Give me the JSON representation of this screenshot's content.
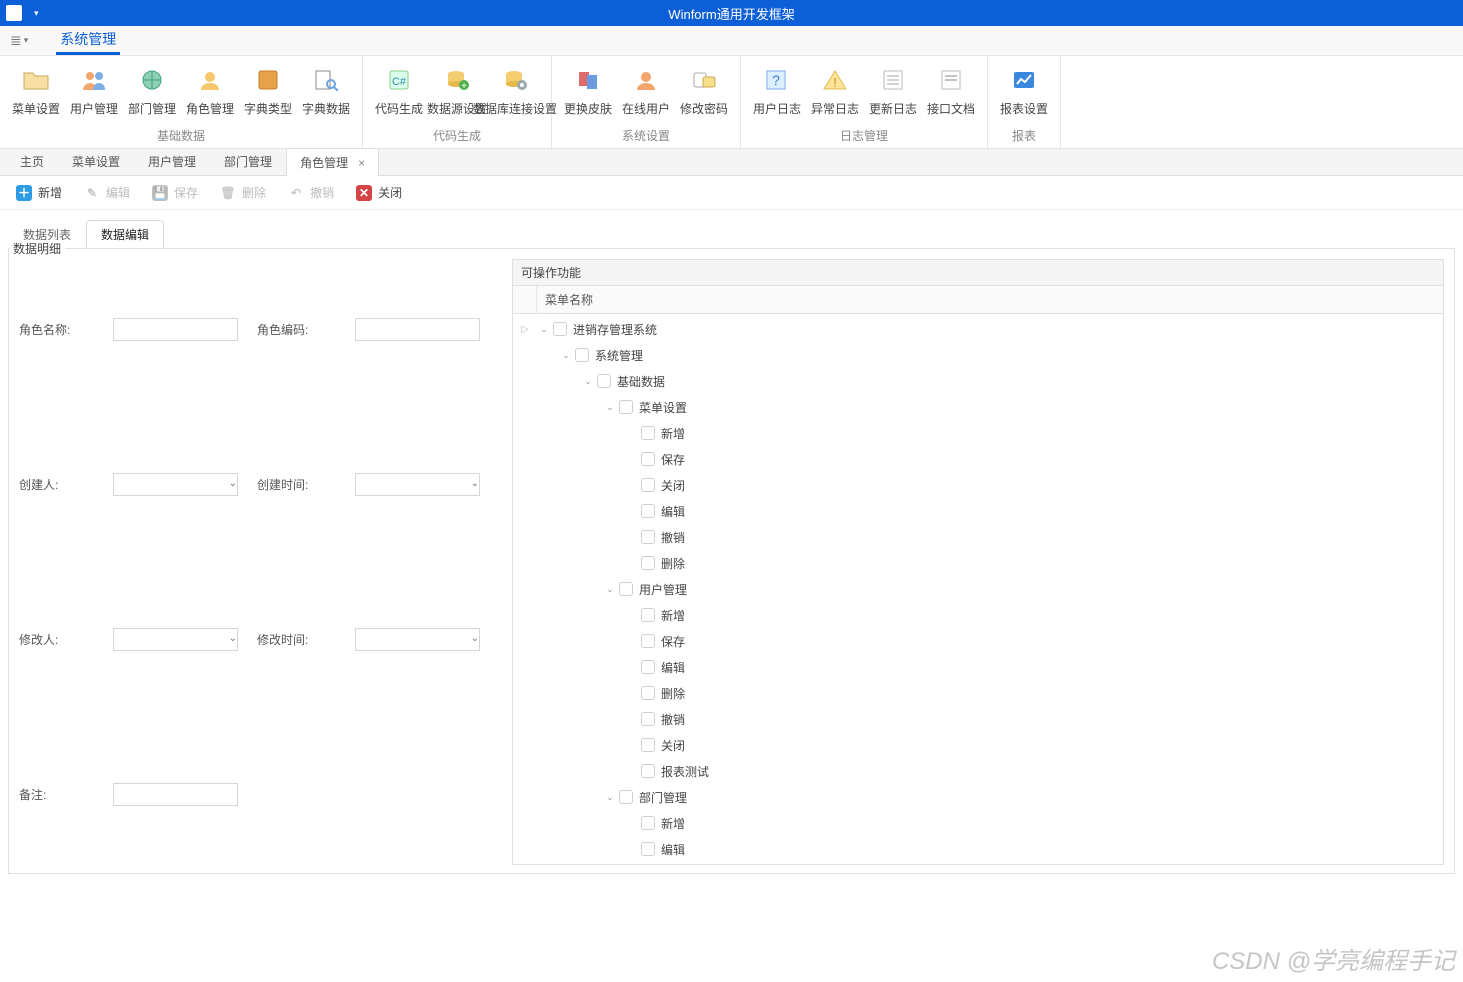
{
  "titlebar": {
    "caption": "Winform通用开发框架"
  },
  "menubar": {
    "dropdown_icon": "≣▾",
    "tabs": [
      {
        "label": "系统管理",
        "active": true
      }
    ]
  },
  "ribbon": {
    "groups": [
      {
        "label": "基础数据",
        "items": [
          {
            "icon": "folder",
            "label": "菜单设置"
          },
          {
            "icon": "users",
            "label": "用户管理"
          },
          {
            "icon": "globe",
            "label": "部门管理"
          },
          {
            "icon": "role",
            "label": "角色管理"
          },
          {
            "icon": "book",
            "label": "字典类型"
          },
          {
            "icon": "search-doc",
            "label": "字典数据"
          }
        ]
      },
      {
        "label": "代码生成",
        "items": [
          {
            "icon": "csharp",
            "label": "代码生成"
          },
          {
            "icon": "db-add",
            "label": "数据源设置"
          },
          {
            "icon": "db-gear",
            "label": "数据库连接设置"
          }
        ]
      },
      {
        "label": "系统设置",
        "items": [
          {
            "icon": "skin",
            "label": "更换皮肤"
          },
          {
            "icon": "online-user",
            "label": "在线用户"
          },
          {
            "icon": "pwd",
            "label": "修改密码"
          }
        ]
      },
      {
        "label": "日志管理",
        "items": [
          {
            "icon": "log-user",
            "label": "用户日志"
          },
          {
            "icon": "log-warn",
            "label": "异常日志"
          },
          {
            "icon": "log-update",
            "label": "更新日志"
          },
          {
            "icon": "api-doc",
            "label": "接口文档"
          }
        ]
      },
      {
        "label": "报表",
        "items": [
          {
            "icon": "chart",
            "label": "报表设置"
          }
        ]
      }
    ]
  },
  "doc_tabs": [
    {
      "label": "主页",
      "active": false
    },
    {
      "label": "菜单设置",
      "active": false
    },
    {
      "label": "用户管理",
      "active": false
    },
    {
      "label": "部门管理",
      "active": false
    },
    {
      "label": "角色管理",
      "active": true
    }
  ],
  "close_x": "×",
  "toolbar": [
    {
      "name": "add",
      "icon": "add",
      "label": "新增",
      "enabled": true
    },
    {
      "name": "edit",
      "icon": "edit",
      "label": "编辑",
      "enabled": false
    },
    {
      "name": "save",
      "icon": "save",
      "label": "保存",
      "enabled": false
    },
    {
      "name": "delete",
      "icon": "del",
      "label": "删除",
      "enabled": false
    },
    {
      "name": "undo",
      "icon": "undo",
      "label": "撤销",
      "enabled": false
    },
    {
      "name": "close",
      "icon": "close",
      "label": "关闭",
      "enabled": true
    }
  ],
  "inner_tabs": [
    {
      "label": "数据列表",
      "active": false
    },
    {
      "label": "数据编辑",
      "active": true
    }
  ],
  "fieldset_legend": "数据明细",
  "form": {
    "role_name_label": "角色名称:",
    "role_name": "",
    "role_code_label": "角色编码:",
    "role_code": "",
    "creator_label": "创建人:",
    "creator": "",
    "ctime_label": "创建时间:",
    "ctime": "",
    "modifier_label": "修改人:",
    "modifier": "",
    "mtime_label": "修改时间:",
    "mtime": "",
    "remark_label": "备注:",
    "remark": ""
  },
  "perm_panel": {
    "title": "可操作功能",
    "header": "菜单名称",
    "tree": [
      {
        "indent": 0,
        "gutter_arrow": true,
        "label": "进销存管理系统"
      },
      {
        "indent": 1,
        "label": "系统管理"
      },
      {
        "indent": 2,
        "label": "基础数据"
      },
      {
        "indent": 3,
        "label": "菜单设置"
      },
      {
        "indent": 4,
        "leaf": true,
        "label": "新增"
      },
      {
        "indent": 4,
        "leaf": true,
        "label": "保存"
      },
      {
        "indent": 4,
        "leaf": true,
        "label": "关闭"
      },
      {
        "indent": 4,
        "leaf": true,
        "label": "编辑"
      },
      {
        "indent": 4,
        "leaf": true,
        "label": "撤销"
      },
      {
        "indent": 4,
        "leaf": true,
        "label": "删除"
      },
      {
        "indent": 3,
        "label": "用户管理"
      },
      {
        "indent": 4,
        "leaf": true,
        "label": "新增"
      },
      {
        "indent": 4,
        "leaf": true,
        "label": "保存"
      },
      {
        "indent": 4,
        "leaf": true,
        "label": "编辑"
      },
      {
        "indent": 4,
        "leaf": true,
        "label": "删除"
      },
      {
        "indent": 4,
        "leaf": true,
        "label": "撤销"
      },
      {
        "indent": 4,
        "leaf": true,
        "label": "关闭"
      },
      {
        "indent": 4,
        "leaf": true,
        "label": "报表测试"
      },
      {
        "indent": 3,
        "label": "部门管理"
      },
      {
        "indent": 4,
        "leaf": true,
        "label": "新增"
      },
      {
        "indent": 4,
        "leaf": true,
        "label": "编辑"
      }
    ]
  },
  "watermark": "CSDN @学亮编程手记"
}
